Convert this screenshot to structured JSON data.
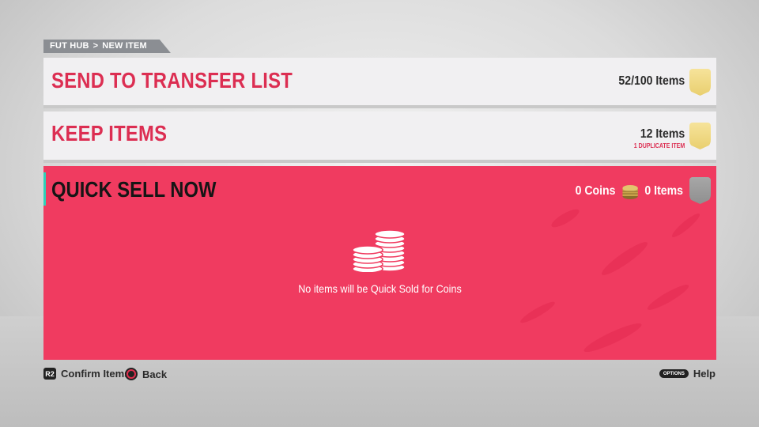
{
  "breadcrumb": {
    "parent": "FUT HUB",
    "separator": ">",
    "current": "NEW ITEM"
  },
  "rows": {
    "transfer": {
      "title": "SEND TO TRANSFER LIST",
      "count": "52/100 Items"
    },
    "keep": {
      "title": "KEEP ITEMS",
      "count": "12 Items",
      "note": "1 DUPLICATE ITEM"
    }
  },
  "quick_sell": {
    "title": "QUICK SELL NOW",
    "coins": "0 Coins",
    "items": "0 Items",
    "message": "No items will be Quick Sold for Coins"
  },
  "footer": {
    "confirm_button": "R2",
    "confirm_label": "Confirm Items",
    "back_label": "Back",
    "options_button": "OPTIONS",
    "help_label": "Help"
  },
  "colors": {
    "accent_red": "#dc2e52",
    "quick_sell_bg": "#f03b60",
    "teal_accent": "#2fd0b8",
    "gold_card": "#f6e39a"
  }
}
